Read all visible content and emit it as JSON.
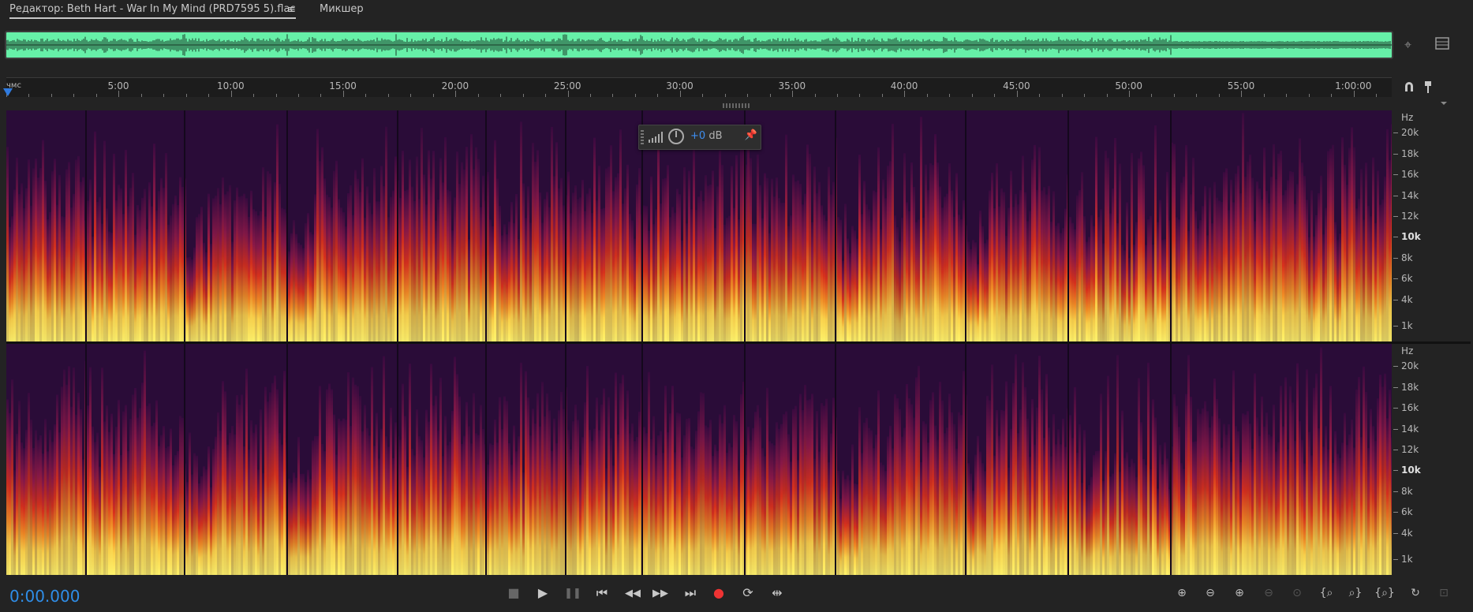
{
  "tabs": {
    "editor": "Редактор: Beth Hart - War In My Mind (PRD7595 5).flac",
    "menu_icon": "≡",
    "mixer": "Микшер"
  },
  "ruler": {
    "unit": "чмс",
    "labels": [
      "5:00",
      "10:00",
      "15:00",
      "20:00",
      "25:00",
      "30:00",
      "35:00",
      "40:00",
      "45:00",
      "50:00",
      "55:00",
      "1:00:00"
    ]
  },
  "frequency_axis": {
    "unit": "Hz",
    "labels": [
      "20k",
      "18k",
      "16k",
      "14k",
      "12k",
      "10k",
      "8k",
      "6k",
      "4k",
      "1k"
    ],
    "emphasized": "10k"
  },
  "hud": {
    "volume_value": "+0",
    "volume_unit": "dB"
  },
  "transport": {
    "timecode": "0:00.000",
    "stop": "■",
    "play": "▶",
    "pause": "❚❚",
    "to_start": "⏮",
    "rewind": "◀◀",
    "fast_forward": "▶▶",
    "to_end": "⏭",
    "record": "●",
    "loop": "⟳",
    "skip_selection": "⇹"
  },
  "zoom": {
    "zoom_in_amplitude": "⊕",
    "zoom_out_amplitude": "⊖",
    "zoom_in_time": "⊕",
    "zoom_out_time": "⊖",
    "zoom_selection": "⊙",
    "zoom_in_left": "{⌕",
    "zoom_in_right": "⌕}",
    "zoom_full": "{⌕}",
    "zoom_reset": "↻",
    "zoom_fit": "⊡"
  },
  "colors": {
    "overview_waveform": "#66f0a8",
    "timecode": "#2f8ee8",
    "record": "#e33333",
    "playhead": "#2f7be0"
  }
}
